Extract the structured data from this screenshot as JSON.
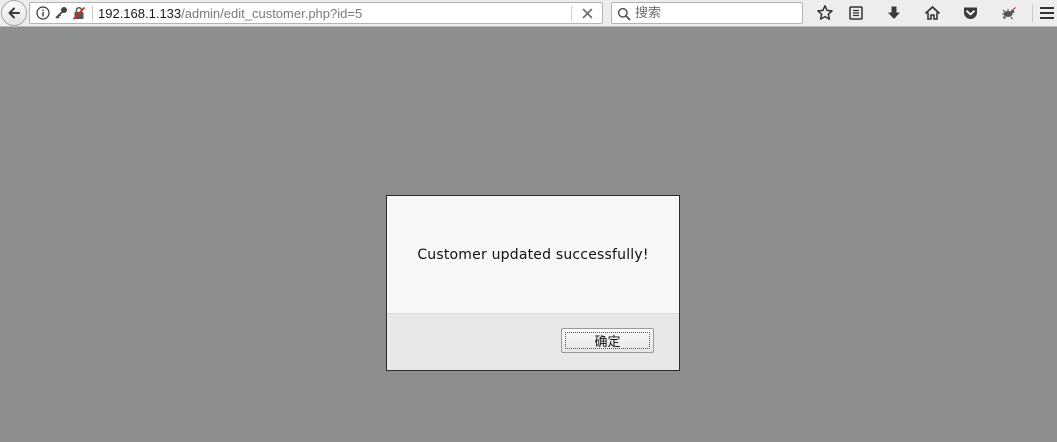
{
  "navbar": {
    "url_host": "192.168.1.133",
    "url_path": "/admin/edit_customer.php?id=5",
    "search_placeholder": "搜索",
    "icons": {
      "back": "back-arrow-icon",
      "info": "info-icon",
      "key": "key-icon",
      "insecure": "insecure-lock-icon",
      "clear": "close-icon",
      "search": "search-icon",
      "bookmark": "star-icon",
      "reading_list": "reader-list-icon",
      "downloads": "download-icon",
      "home": "home-icon",
      "pocket": "pocket-icon",
      "extension": "bug-icon",
      "menu": "hamburger-menu-icon"
    }
  },
  "dialog": {
    "message": "Customer updated successfully!",
    "ok_label": "确定"
  },
  "colors": {
    "page_overlay": "#8d8e90",
    "dialog_body": "#f7f7f7",
    "dialog_footer": "#e8e8e8",
    "toolbar": "#ededec"
  }
}
